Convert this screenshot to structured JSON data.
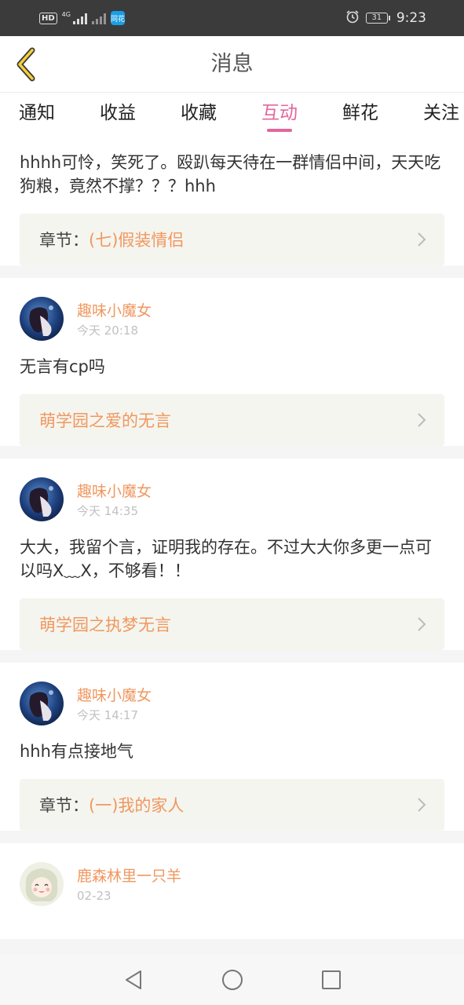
{
  "status_bar": {
    "hd": "HD",
    "network": "4G",
    "app_badge": "同花",
    "battery": "31",
    "time": "9:23"
  },
  "header": {
    "title": "消息",
    "back_icon": "chevron-left-icon"
  },
  "tabs": [
    {
      "label": "通知",
      "active": false
    },
    {
      "label": "收益",
      "active": false
    },
    {
      "label": "收藏",
      "active": false
    },
    {
      "label": "互动",
      "active": true
    },
    {
      "label": "鲜花",
      "active": false
    },
    {
      "label": "关注",
      "active": false
    }
  ],
  "colors": {
    "accent_pink": "#e2679b",
    "name_orange": "#f0975f",
    "ref_bg": "#f5f5ef"
  },
  "messages": [
    {
      "text": "hhhh可怜，笑死了。殴趴每天待在一群情侣中间，天天吃狗粮，竟然不撑？？？hhh",
      "ref_prefix": "章节：",
      "ref_title": "(七)假装情侣"
    },
    {
      "username": "趣味小魔女",
      "time": "今天 20:18",
      "text": "无言有cp吗",
      "ref_prefix": "",
      "ref_title": "萌学园之爱的无言"
    },
    {
      "username": "趣味小魔女",
      "time": "今天 14:35",
      "text": "大大，我留个言，证明我的存在。不过大大你多更一点可以吗X﹏X，不够看！！",
      "ref_prefix": "",
      "ref_title": "萌学园之执梦无言"
    },
    {
      "username": "趣味小魔女",
      "time": "今天 14:17",
      "text": "hhh有点接地气",
      "ref_prefix": "章节：",
      "ref_title": "(一)我的家人"
    },
    {
      "username": "鹿森林里一只羊",
      "time": "02-23"
    }
  ],
  "nav": {
    "back": "triangle-back-icon",
    "home": "circle-home-icon",
    "recent": "square-recent-icon"
  }
}
